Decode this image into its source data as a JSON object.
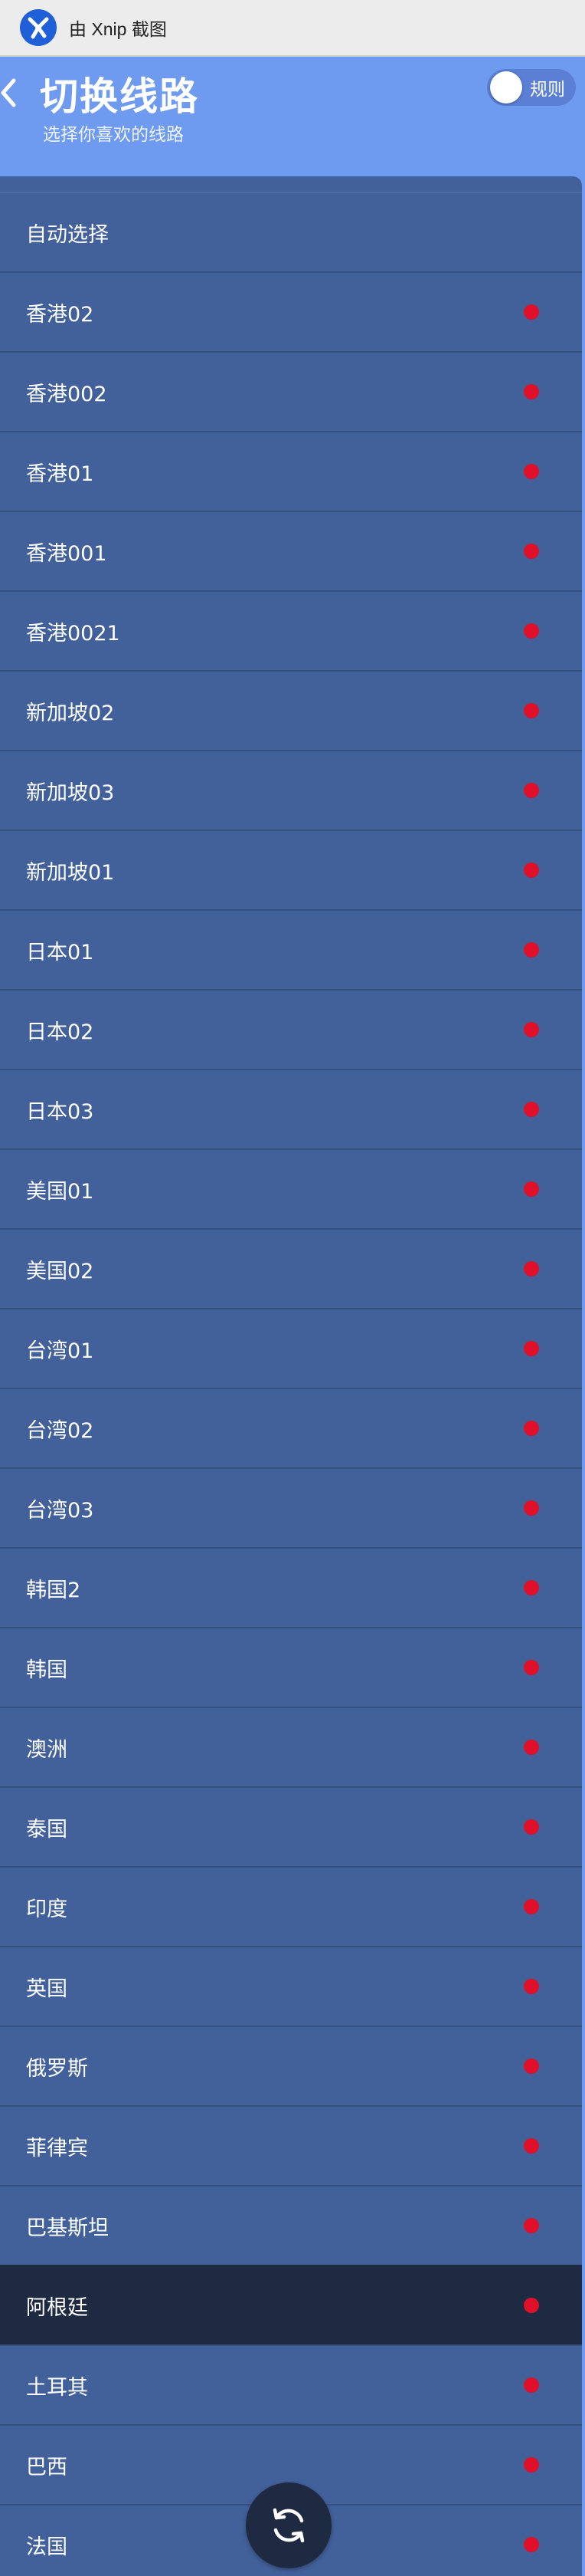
{
  "watermark": {
    "text": "由 Xnip 截图"
  },
  "header": {
    "title": "切换线路",
    "subtitle": "选择你喜欢的线路",
    "rules_label": "规则"
  },
  "colors": {
    "header_bg": "#6e9af0",
    "list_bg": "#42609a",
    "selected_bg": "#1e2a42",
    "status_dot": "#e0102a"
  },
  "routes": [
    {
      "label": "自动选择"
    },
    {
      "label": "香港02"
    },
    {
      "label": "香港002"
    },
    {
      "label": "香港01"
    },
    {
      "label": "香港001"
    },
    {
      "label": "香港0021"
    },
    {
      "label": "新加坡02"
    },
    {
      "label": "新加坡03"
    },
    {
      "label": "新加坡01"
    },
    {
      "label": "日本01"
    },
    {
      "label": "日本02"
    },
    {
      "label": "日本03"
    },
    {
      "label": "美国01"
    },
    {
      "label": "美国02"
    },
    {
      "label": "台湾01"
    },
    {
      "label": "台湾02"
    },
    {
      "label": "台湾03"
    },
    {
      "label": "韩国2"
    },
    {
      "label": "韩国"
    },
    {
      "label": "澳洲"
    },
    {
      "label": "泰国"
    },
    {
      "label": "印度"
    },
    {
      "label": "英国"
    },
    {
      "label": "俄罗斯"
    },
    {
      "label": "菲律宾"
    },
    {
      "label": "巴基斯坦"
    },
    {
      "label": "阿根廷"
    },
    {
      "label": "土耳其"
    },
    {
      "label": "巴西"
    },
    {
      "label": "法国"
    }
  ],
  "selected_route": "阿根廷",
  "icons": {
    "app_logo": "xnip-logo-icon",
    "back": "chevron-left-icon",
    "refresh": "refresh-icon"
  }
}
